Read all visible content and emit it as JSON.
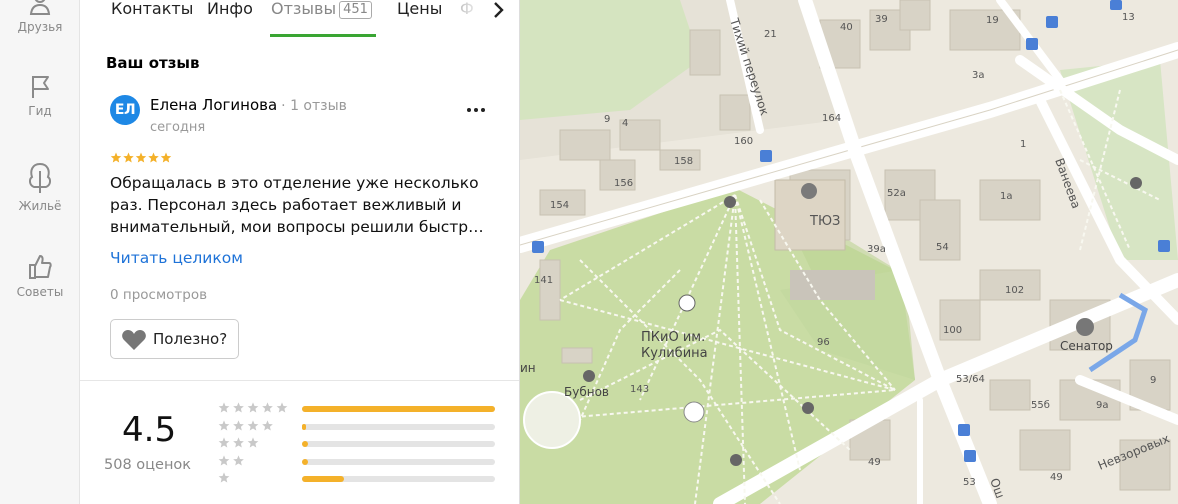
{
  "rail": {
    "items": [
      {
        "label": "Друзья",
        "icon": "friends-icon"
      },
      {
        "label": "Гид",
        "icon": "flag-icon"
      },
      {
        "label": "Жильё",
        "icon": "housing-icon"
      },
      {
        "label": "Советы",
        "icon": "thumbs-up-icon"
      }
    ]
  },
  "tabs": {
    "items": [
      {
        "label": "Контакты"
      },
      {
        "label": "Инфо"
      },
      {
        "label": "Отзывы",
        "count": "451",
        "active": true
      },
      {
        "label": "Цены"
      },
      {
        "label": "Ф"
      }
    ]
  },
  "review": {
    "section_title": "Ваш отзыв",
    "avatar_initials": "ЕЛ",
    "author_name": "Елена Логинова",
    "author_meta": "· 1 отзыв",
    "date": "сегодня",
    "stars": 5,
    "text": "Обращалась в это отделение уже несколько раз. Персонал здесь работает вежливый и внимательный, мои вопросы решили быстр…",
    "read_more": "Читать целиком",
    "views": "0 просмотров",
    "useful_label": "Полезно?"
  },
  "rating": {
    "value": "4.5",
    "count_label": "508 оценок",
    "distribution": [
      {
        "stars": 5,
        "fraction": 1.0
      },
      {
        "stars": 4,
        "fraction": 0.01
      },
      {
        "stars": 3,
        "fraction": 0.03
      },
      {
        "stars": 2,
        "fraction": 0.03
      },
      {
        "stars": 1,
        "fraction": 0.22
      }
    ]
  },
  "map": {
    "labels": {
      "tiy": "ТЮЗ",
      "park1": "ПКиО им.",
      "park2": "Кулибина",
      "bubnov": "Бубнов",
      "senator": "Сенатор",
      "street_tikhiy": "Тихий переулок",
      "street_vaneeva": "Ванеева",
      "street_nevzor": "Невзоровых",
      "street_osh": "Ош",
      "partial_in": "ин"
    },
    "house_numbers": [
      "40",
      "39",
      "21",
      "3a",
      "19",
      "13",
      "4",
      "9",
      "164",
      "160",
      "158",
      "156",
      "154",
      "141",
      "52а",
      "39а",
      "54",
      "1a",
      "1",
      "102",
      "100",
      "96",
      "143",
      "53/64",
      "55б",
      "9а",
      "9",
      "49",
      "53",
      "49"
    ],
    "colors": {
      "park": "#c7dba1",
      "road": "#ffffff",
      "block": "#e2ded3",
      "building": "#d6d1c4",
      "transit": "#4a7fd6"
    }
  }
}
